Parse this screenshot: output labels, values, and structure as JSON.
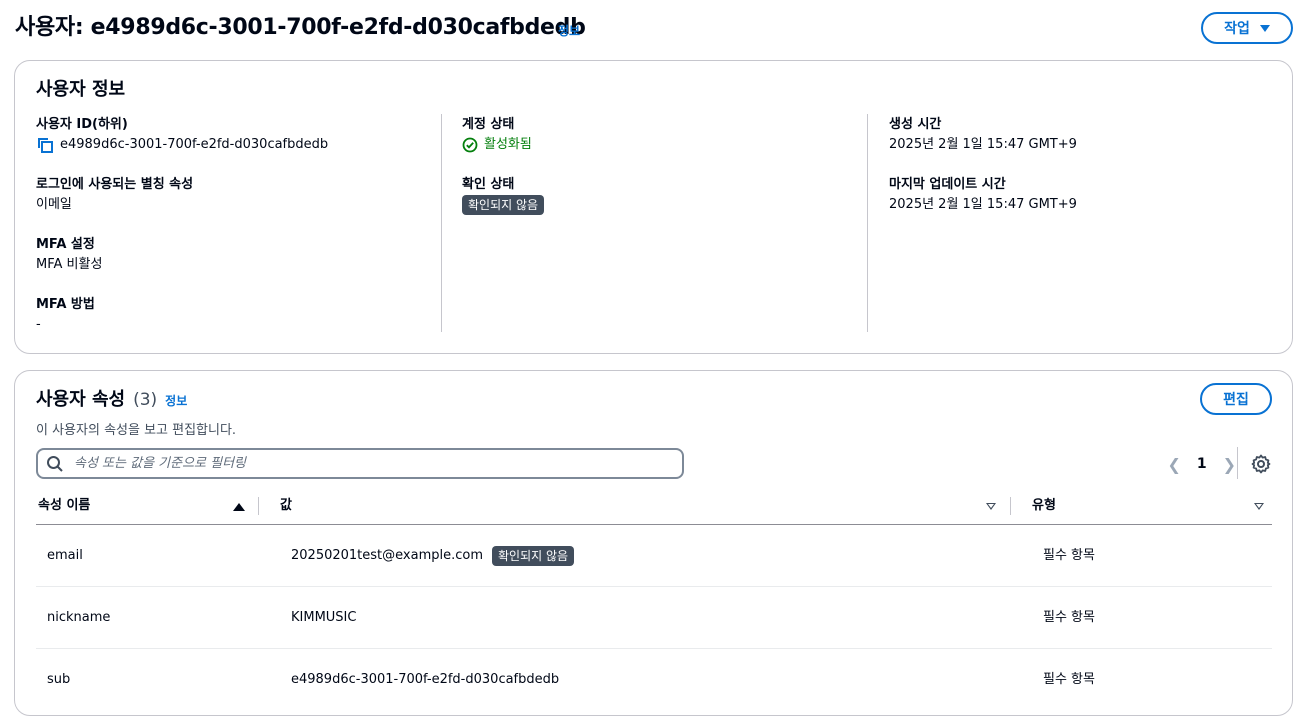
{
  "header": {
    "title": "사용자: e4989d6c-3001-700f-e2fd-d030cafbdedb",
    "info_label": "정보",
    "actions_label": "작업"
  },
  "user_info": {
    "title": "사용자 정보",
    "user_id_label": "사용자 ID(하위)",
    "user_id_value": "e4989d6c-3001-700f-e2fd-d030cafbdedb",
    "alias_label": "로그인에 사용되는 별칭 속성",
    "alias_value": "이메일",
    "mfa_setting_label": "MFA 설정",
    "mfa_setting_value": "MFA 비활성",
    "mfa_method_label": "MFA 방법",
    "mfa_method_value": "-",
    "account_status_label": "계정 상태",
    "account_status_value": "활성화됨",
    "confirmation_status_label": "확인 상태",
    "confirmation_status_value": "확인되지 않음",
    "created_label": "생성 시간",
    "created_value": "2025년 2월 1일 15:47 GMT+9",
    "updated_label": "마지막 업데이트 시간",
    "updated_value": "2025년 2월 1일 15:47 GMT+9"
  },
  "attributes": {
    "title": "사용자 속성",
    "count": "(3)",
    "info_label": "정보",
    "description": "이 사용자의 속성을 보고 편집합니다.",
    "edit_label": "편집",
    "search_placeholder": "속성 또는 값을 기준으로 필터링",
    "page": "1",
    "columns": [
      "속성 이름",
      "값",
      "유형"
    ],
    "rows": [
      {
        "name": "email",
        "value": "20250201test@example.com",
        "badge": "확인되지 않음",
        "type": "필수 항목"
      },
      {
        "name": "nickname",
        "value": "KIMMUSIC",
        "badge": "",
        "type": "필수 항목"
      },
      {
        "name": "sub",
        "value": "e4989d6c-3001-700f-e2fd-d030cafbdedb",
        "badge": "",
        "type": "필수 항목"
      }
    ]
  },
  "colors": {
    "accent": "#0972d3",
    "success": "#037f0c",
    "badge_bg": "#414d5c"
  }
}
